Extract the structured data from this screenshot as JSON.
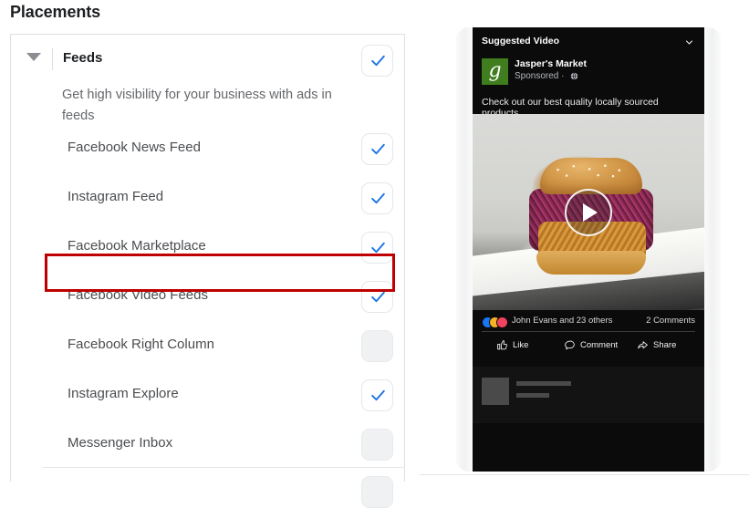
{
  "page": {
    "title": "Placements"
  },
  "placements_card": {
    "group": {
      "label": "Feeds",
      "description": "Get high visibility for your business with ads in feeds",
      "caret_icon": "triangle-down-icon",
      "checked": true,
      "checkbox_icon": "checkmark-icon"
    },
    "items": [
      {
        "label": "Facebook News Feed",
        "checked": true,
        "highlighted": false
      },
      {
        "label": "Instagram Feed",
        "checked": true,
        "highlighted": false
      },
      {
        "label": "Facebook Marketplace",
        "checked": true,
        "highlighted": false
      },
      {
        "label": "Facebook Video Feeds",
        "checked": true,
        "highlighted": true
      },
      {
        "label": "Facebook Right Column",
        "checked": false,
        "highlighted": false
      },
      {
        "label": "Instagram Explore",
        "checked": true,
        "highlighted": false
      },
      {
        "label": "Messenger Inbox",
        "checked": false,
        "highlighted": false
      }
    ],
    "next_section_partial_checkbox": {
      "checked": false
    }
  },
  "annotation": {
    "target_label": "Facebook Video Feeds",
    "color": "#c00000"
  },
  "colors": {
    "checkmark_blue": "#1b74e4",
    "checkbox_unchecked_fill": "#f0f1f3",
    "card_border": "#dedfe2",
    "heading_text": "#1c1e21",
    "body_text": "#65676b",
    "item_text": "#4b4d50",
    "brand_logo_green": "#3f7d1e",
    "phone_screen_bg": "#0b0b0b"
  },
  "preview": {
    "device": "phone-mockup",
    "post": {
      "section_label": "Suggested Video",
      "collapse_icon": "chevron-down-icon",
      "advertiser_name": "Jasper's Market",
      "advertiser_logo_glyph": "g",
      "sponsored_label": "Sponsored",
      "sponsored_separator": "·",
      "audience_icon": "globe-icon",
      "body_text": "Check out our best quality locally sourced products.",
      "media_type": "video",
      "media_alt": "fried chicken sandwich with red cabbage slaw on a white plate",
      "play_icon": "play-icon",
      "reactions": [
        {
          "name": "like-reaction-icon",
          "glyph": "▲",
          "color": "#1877f2"
        },
        {
          "name": "wow-reaction-icon",
          "glyph": "●",
          "color": "#f7b125"
        },
        {
          "name": "love-reaction-icon",
          "glyph": "♥",
          "color": "#f3425f"
        }
      ],
      "engagement_text": "John Evans and 23 others",
      "comments_count": "2 Comments",
      "actions": [
        {
          "label": "Like",
          "icon": "thumbs-up-icon"
        },
        {
          "label": "Comment",
          "icon": "comment-bubble-icon"
        },
        {
          "label": "Share",
          "icon": "share-arrow-icon"
        }
      ]
    }
  }
}
